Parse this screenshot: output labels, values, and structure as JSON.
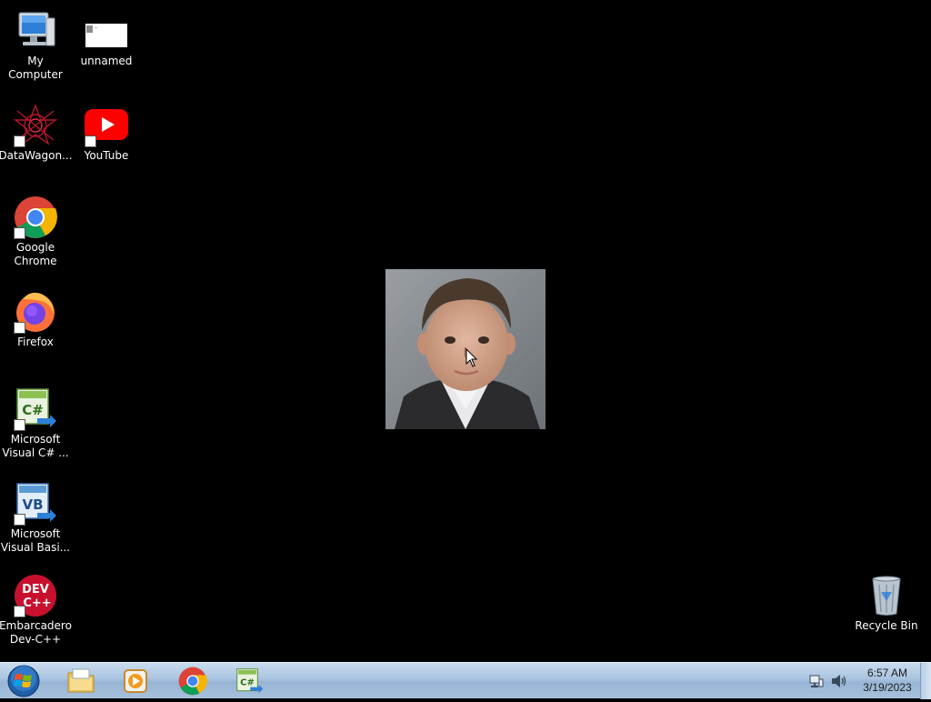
{
  "desktop": {
    "icons": [
      {
        "label": "My Computer",
        "icon": "computer-icon"
      },
      {
        "label": "unnamed",
        "icon": "image-file-icon"
      },
      {
        "label": "DataWagon...",
        "icon": "datawagon-icon"
      },
      {
        "label": "YouTube",
        "icon": "youtube-icon"
      },
      {
        "label": "Google\nChrome",
        "icon": "chrome-icon"
      },
      {
        "label": "Firefox",
        "icon": "firefox-icon"
      },
      {
        "label": "Microsoft\nVisual C# ...",
        "icon": "visual-csharp-icon"
      },
      {
        "label": "Microsoft\nVisual Basi...",
        "icon": "visual-basic-icon"
      },
      {
        "label": "Embarcadero\nDev-C++",
        "icon": "devcpp-icon"
      },
      {
        "label": "Recycle Bin",
        "icon": "recycle-bin-icon"
      }
    ],
    "icon_text": {
      "csharp": "C#",
      "vb": "VB",
      "dev_top": "DEV",
      "dev_bottom": "C++"
    }
  },
  "photo": {
    "icon": "portrait-photo"
  },
  "taskbar": {
    "start": {
      "icon": "windows-start-orb-icon"
    },
    "pinned": [
      {
        "icon": "file-explorer-icon"
      },
      {
        "icon": "media-player-icon"
      },
      {
        "icon": "chrome-icon"
      },
      {
        "icon": "visual-csharp-icon",
        "text": "C#"
      }
    ],
    "tray": {
      "network_icon": "network-icon",
      "volume_icon": "volume-icon",
      "time": "6:57 AM",
      "date": "3/19/2023"
    }
  },
  "colors": {
    "desktop_bg": "#000000",
    "taskbar_top": "#c9dcef",
    "taskbar_bottom": "#a7c1dd",
    "youtube_red": "#ff0000",
    "devcpp_red": "#c8102e"
  }
}
